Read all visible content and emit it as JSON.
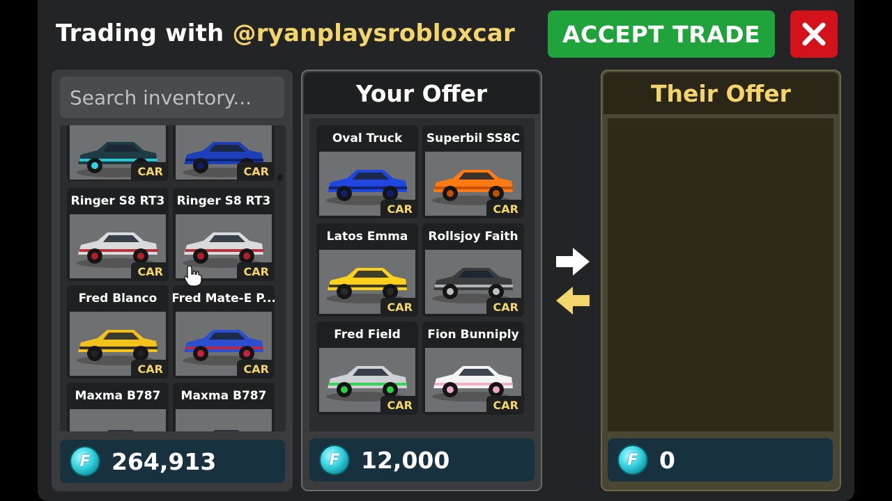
{
  "header": {
    "title_prefix": "Trading with ",
    "username": "@ryanplaysrobloxcar",
    "accept_label": "ACCEPT TRADE"
  },
  "inventory": {
    "search_placeholder": "Search inventory...",
    "items": [
      {
        "name": "",
        "tag": "CAR",
        "color": "#1d3c44",
        "accent": "#2fd3df"
      },
      {
        "name": "",
        "tag": "CAR",
        "color": "#1d3fb8",
        "accent": "#0e1e6a"
      },
      {
        "name": "Ringer S8 RT3",
        "tag": "CAR",
        "color": "#d9dadb",
        "accent": "#b21f28"
      },
      {
        "name": "Ringer S8 RT3",
        "tag": "CAR",
        "color": "#d9dadb",
        "accent": "#b21f28"
      },
      {
        "name": "Fred Blanco",
        "tag": "CAR",
        "color": "#f2c21b",
        "accent": "#222222"
      },
      {
        "name": "Fred Mate-E P...",
        "tag": "CAR",
        "color": "#2b4fd0",
        "accent": "#c8233a"
      },
      {
        "name": "Maxma B787",
        "tag": "",
        "color": "#6f7072",
        "accent": "#e86a1a"
      },
      {
        "name": "Maxma B787",
        "tag": "",
        "color": "#6f7072",
        "accent": "#e86a1a"
      }
    ],
    "balance": "264,913"
  },
  "your_offer": {
    "title": "Your Offer",
    "items": [
      {
        "name": "Oval Truck",
        "tag": "CAR",
        "color": "#1f47e0",
        "accent": "#0f1f70"
      },
      {
        "name": "Superbil SS8C",
        "tag": "CAR",
        "color": "#ff7a12",
        "accent": "#c24e00"
      },
      {
        "name": "Latos Emma",
        "tag": "CAR",
        "color": "#ffd21a",
        "accent": "#2a2a2a"
      },
      {
        "name": "Rollsjoy Faith",
        "tag": "CAR",
        "color": "#3b3c3e",
        "accent": "#bfc0c2"
      },
      {
        "name": "Fred Field",
        "tag": "CAR",
        "color": "#cfd2d4",
        "accent": "#2ad04a"
      },
      {
        "name": "Fion Bunniply",
        "tag": "CAR",
        "color": "#f4f4f4",
        "accent": "#f0a6c8"
      }
    ],
    "balance": "12,000"
  },
  "their_offer": {
    "title": "Their Offer",
    "items": [],
    "balance": "0"
  },
  "colors": {
    "accept": "#1fa33a",
    "close": "#d4121b",
    "gold": "#f4d56b",
    "panel": "#3a3b3c"
  },
  "icons": {
    "close": "close-x-icon",
    "coin": "coin-icon",
    "send": "arrow-right-icon",
    "receive": "arrow-left-icon",
    "cursor": "hand-pointer-icon"
  }
}
